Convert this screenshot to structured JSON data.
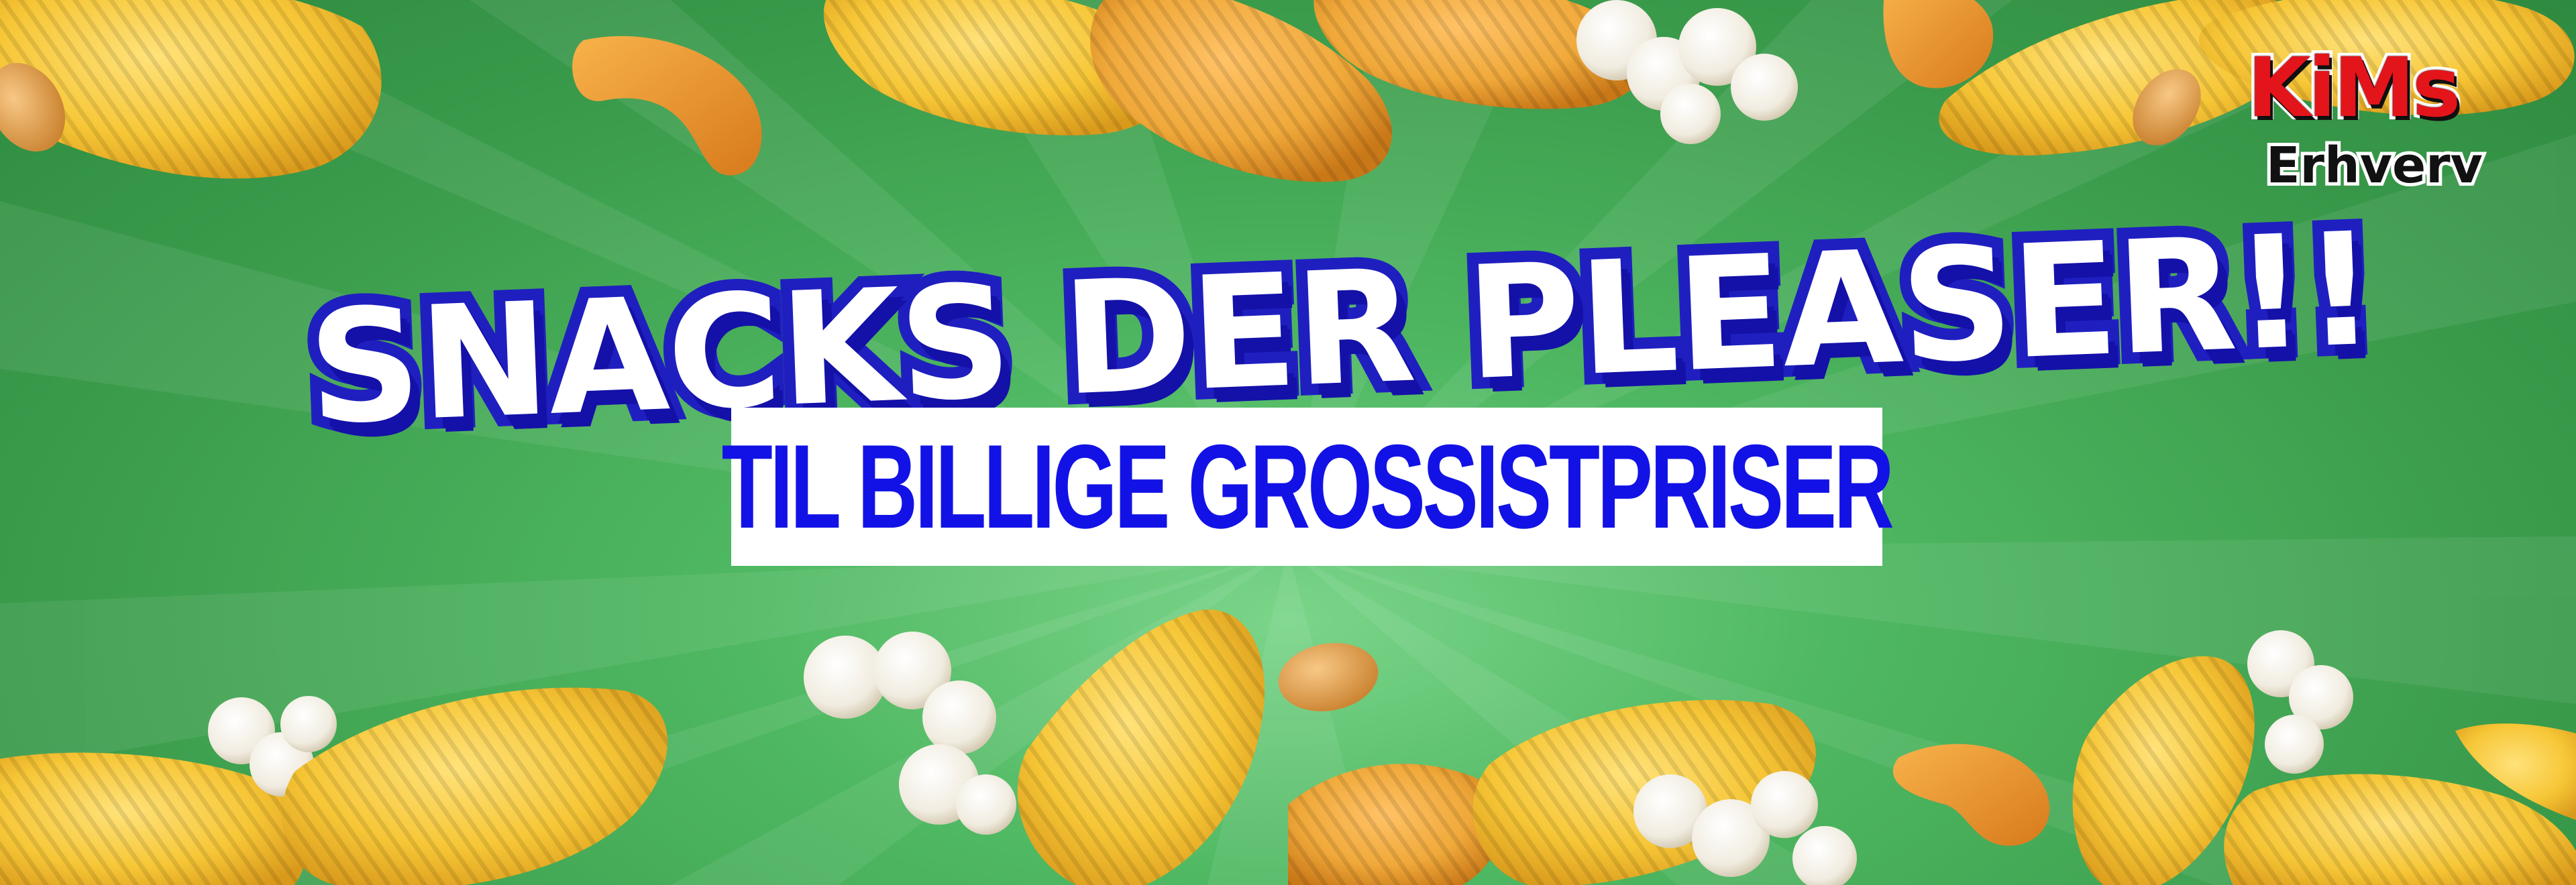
{
  "banner": {
    "headline": "SNACKS DER PLEASER!!",
    "subheadline": "TIL BILLIGE GROSSISTPRISER"
  },
  "logo": {
    "brand": "KiMs",
    "tagline": "Erhverv"
  },
  "colors": {
    "background": "#3fa14e",
    "headline_fill": "#ffffff",
    "headline_outline": "#1f1fc0",
    "subheadline_text": "#1212e6",
    "subheadline_box": "#ffffff",
    "logo_red": "#e4141b",
    "chip_yellow": "#f2c43a",
    "chip_orange": "#e8982e",
    "popcorn_white": "#f6f3ea",
    "peanut_tan": "#e0a24a"
  },
  "decorations": [
    "potato-chip",
    "ridged-chip",
    "popcorn",
    "peanut",
    "cheese-curl"
  ]
}
